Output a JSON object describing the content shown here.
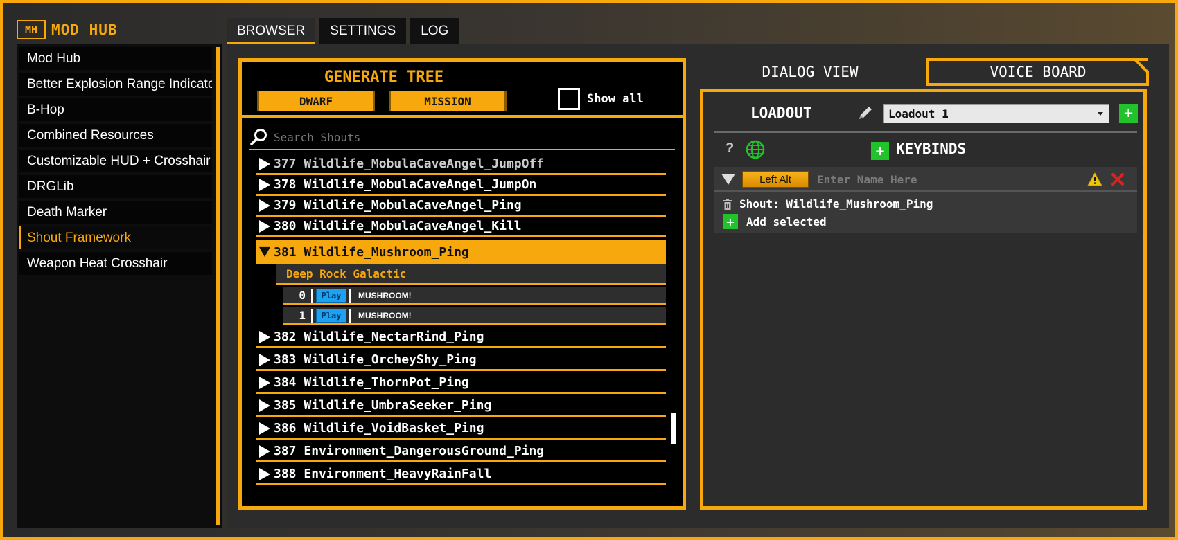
{
  "app": {
    "logo_abbr": "MH",
    "logo_text": "MOD HUB"
  },
  "tabs": [
    {
      "label": "BROWSER",
      "active": true
    },
    {
      "label": "SETTINGS",
      "active": false
    },
    {
      "label": "LOG",
      "active": false
    }
  ],
  "sidebar": {
    "items": [
      {
        "label": "Mod Hub"
      },
      {
        "label": "Better Explosion Range Indicator"
      },
      {
        "label": "B-Hop"
      },
      {
        "label": "Combined Resources"
      },
      {
        "label": "Customizable HUD + Crosshair"
      },
      {
        "label": "DRGLib"
      },
      {
        "label": "Death Marker"
      },
      {
        "label": "Shout Framework",
        "active": true
      },
      {
        "label": "Weapon Heat Crosshair"
      }
    ]
  },
  "generate": {
    "title": "GENERATE TREE",
    "dwarf_label": "DWARF",
    "mission_label": "MISSION",
    "show_all_label": "Show all",
    "show_all_checked": false
  },
  "search": {
    "placeholder": "Search Shouts"
  },
  "tree": {
    "rows_before": [
      {
        "id": "377",
        "name": "Wildlife_MobulaCaveAngel_JumpOff"
      },
      {
        "id": "378",
        "name": "Wildlife_MobulaCaveAngel_JumpOn"
      },
      {
        "id": "379",
        "name": "Wildlife_MobulaCaveAngel_Ping"
      },
      {
        "id": "380",
        "name": "Wildlife_MobulaCaveAngel_Kill"
      }
    ],
    "expanded": {
      "id": "381",
      "name": "Wildlife_Mushroom_Ping",
      "group": "Deep Rock Galactic",
      "voices": [
        {
          "index": "0",
          "play_label": "Play",
          "text": "MUSHROOM!"
        },
        {
          "index": "1",
          "play_label": "Play",
          "text": "MUSHROOM!"
        }
      ]
    },
    "rows_after": [
      {
        "id": "382",
        "name": "Wildlife_NectarRind_Ping"
      },
      {
        "id": "383",
        "name": "Wildlife_OrcheyShy_Ping"
      },
      {
        "id": "384",
        "name": "Wildlife_ThornPot_Ping"
      },
      {
        "id": "385",
        "name": "Wildlife_UmbraSeeker_Ping"
      },
      {
        "id": "386",
        "name": "Wildlife_VoidBasket_Ping"
      },
      {
        "id": "387",
        "name": "Environment_DangerousGround_Ping"
      },
      {
        "id": "388",
        "name": "Environment_HeavyRainFall"
      }
    ]
  },
  "right": {
    "tab_dialog": "DIALOG VIEW",
    "tab_voice": "VOICE BOARD",
    "loadout_label": "LOADOUT",
    "loadout_value": "Loadout 1",
    "add_symbol": "+",
    "help_symbol": "?",
    "keybinds_label": "KEYBINDS",
    "keybind": {
      "key": "Left Alt",
      "name_placeholder": "Enter Name Here",
      "shout": "Shout: Wildlife_Mushroom_Ping",
      "add_selected": "Add selected"
    }
  },
  "colors": {
    "accent": "#f6a80d",
    "green": "#22c32a",
    "play_blue": "#1da1f2",
    "danger": "#e02020"
  }
}
